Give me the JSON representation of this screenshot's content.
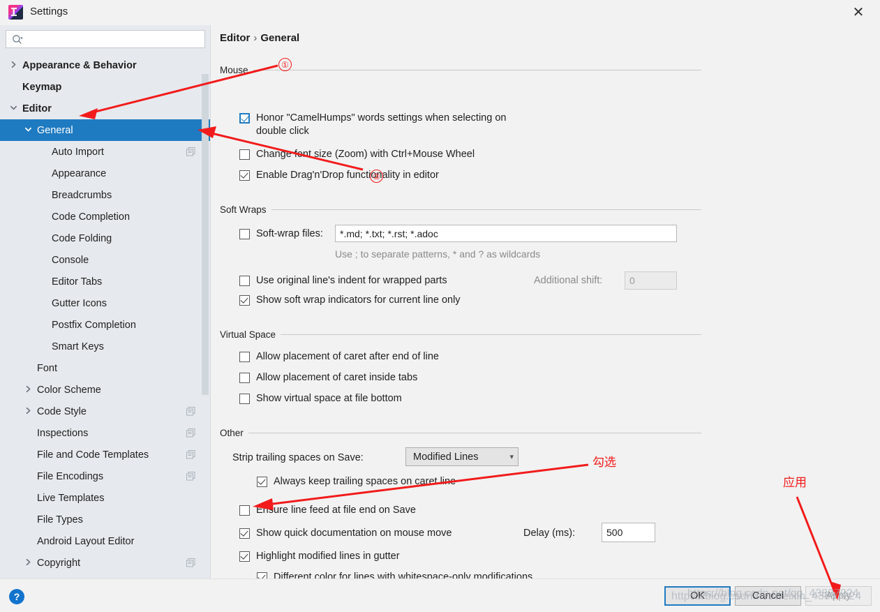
{
  "window": {
    "title": "Settings",
    "logo_icon": "intellij-idea-icon",
    "close_icon": "close-icon"
  },
  "sidebar": {
    "search": {
      "placeholder": "",
      "value": "",
      "icon": "search-icon"
    },
    "items": [
      {
        "label": "Appearance & Behavior",
        "indent": 0,
        "chevron": "right",
        "bold": true,
        "selected": false,
        "badge": false
      },
      {
        "label": "Keymap",
        "indent": 0,
        "chevron": "none",
        "bold": true,
        "selected": false,
        "badge": false
      },
      {
        "label": "Editor",
        "indent": 0,
        "chevron": "down",
        "bold": true,
        "selected": false,
        "badge": false
      },
      {
        "label": "General",
        "indent": 1,
        "chevron": "down",
        "bold": false,
        "selected": true,
        "badge": false
      },
      {
        "label": "Auto Import",
        "indent": 2,
        "chevron": "none",
        "bold": false,
        "selected": false,
        "badge": true
      },
      {
        "label": "Appearance",
        "indent": 2,
        "chevron": "none",
        "bold": false,
        "selected": false,
        "badge": false
      },
      {
        "label": "Breadcrumbs",
        "indent": 2,
        "chevron": "none",
        "bold": false,
        "selected": false,
        "badge": false
      },
      {
        "label": "Code Completion",
        "indent": 2,
        "chevron": "none",
        "bold": false,
        "selected": false,
        "badge": false
      },
      {
        "label": "Code Folding",
        "indent": 2,
        "chevron": "none",
        "bold": false,
        "selected": false,
        "badge": false
      },
      {
        "label": "Console",
        "indent": 2,
        "chevron": "none",
        "bold": false,
        "selected": false,
        "badge": false
      },
      {
        "label": "Editor Tabs",
        "indent": 2,
        "chevron": "none",
        "bold": false,
        "selected": false,
        "badge": false
      },
      {
        "label": "Gutter Icons",
        "indent": 2,
        "chevron": "none",
        "bold": false,
        "selected": false,
        "badge": false
      },
      {
        "label": "Postfix Completion",
        "indent": 2,
        "chevron": "none",
        "bold": false,
        "selected": false,
        "badge": false
      },
      {
        "label": "Smart Keys",
        "indent": 2,
        "chevron": "none",
        "bold": false,
        "selected": false,
        "badge": false
      },
      {
        "label": "Font",
        "indent": 1,
        "chevron": "none",
        "bold": false,
        "selected": false,
        "badge": false
      },
      {
        "label": "Color Scheme",
        "indent": 1,
        "chevron": "right",
        "bold": false,
        "selected": false,
        "badge": false
      },
      {
        "label": "Code Style",
        "indent": 1,
        "chevron": "right",
        "bold": false,
        "selected": false,
        "badge": true
      },
      {
        "label": "Inspections",
        "indent": 1,
        "chevron": "none",
        "bold": false,
        "selected": false,
        "badge": true
      },
      {
        "label": "File and Code Templates",
        "indent": 1,
        "chevron": "none",
        "bold": false,
        "selected": false,
        "badge": true
      },
      {
        "label": "File Encodings",
        "indent": 1,
        "chevron": "none",
        "bold": false,
        "selected": false,
        "badge": true
      },
      {
        "label": "Live Templates",
        "indent": 1,
        "chevron": "none",
        "bold": false,
        "selected": false,
        "badge": false
      },
      {
        "label": "File Types",
        "indent": 1,
        "chevron": "none",
        "bold": false,
        "selected": false,
        "badge": false
      },
      {
        "label": "Android Layout Editor",
        "indent": 1,
        "chevron": "none",
        "bold": false,
        "selected": false,
        "badge": false
      },
      {
        "label": "Copyright",
        "indent": 1,
        "chevron": "right",
        "bold": false,
        "selected": false,
        "badge": true
      }
    ]
  },
  "main": {
    "breadcrumb": {
      "root": "Editor",
      "separator": "›",
      "leaf": "General"
    },
    "sections": {
      "mouse": {
        "title": "Mouse",
        "options": [
          {
            "label": "Honor \"CamelHumps\" words settings when selecting on double click",
            "checked": true,
            "focused": true
          },
          {
            "label": "Change font size (Zoom) with Ctrl+Mouse Wheel",
            "checked": false,
            "focused": false
          },
          {
            "label": "Enable Drag'n'Drop functionality in editor",
            "checked": true,
            "focused": false
          }
        ]
      },
      "soft_wraps": {
        "title": "Soft Wraps",
        "softwrap_files_label": "Soft-wrap files:",
        "softwrap_files_checked": false,
        "softwrap_files_value": "*.md; *.txt; *.rst; *.adoc",
        "hint": "Use ; to separate patterns, * and ? as wildcards",
        "use_original_indent_label": "Use original line's indent for wrapped parts",
        "use_original_indent_checked": false,
        "additional_shift_label": "Additional shift:",
        "additional_shift_value": "0",
        "additional_shift_disabled": true,
        "show_indicators_label": "Show soft wrap indicators for current line only",
        "show_indicators_checked": true
      },
      "virtual_space": {
        "title": "Virtual Space",
        "options": [
          {
            "label": "Allow placement of caret after end of line",
            "checked": false
          },
          {
            "label": "Allow placement of caret inside tabs",
            "checked": false
          },
          {
            "label": "Show virtual space at file bottom",
            "checked": false
          }
        ]
      },
      "other": {
        "title": "Other",
        "strip_label": "Strip trailing spaces on Save:",
        "strip_value": "Modified Lines",
        "strip_caret_icon": "chevron-down-icon",
        "always_keep_label": "Always keep trailing spaces on caret line",
        "always_keep_checked": true,
        "ensure_lf_label": "Ensure line feed at file end on Save",
        "ensure_lf_checked": false,
        "quick_doc_label": "Show quick documentation on mouse move",
        "quick_doc_checked": true,
        "delay_label": "Delay (ms):",
        "delay_value": "500",
        "highlight_label": "Highlight modified lines in gutter",
        "highlight_checked": true,
        "different_color_label": "Different color for lines with whitespace-only modifications",
        "different_color_checked": true
      }
    }
  },
  "footer": {
    "help_label": "?",
    "ok_label": "OK",
    "cancel_label": "Cancel",
    "apply_label": "Apply",
    "apply_disabled": true
  },
  "annotations": {
    "marker_one": "①",
    "marker_two": "②",
    "note_check": "勾选",
    "note_apply": "应用",
    "accent_color": "#f21b1b"
  },
  "watermark": {
    "line1": "https://blog.csdn.net/qq_43887224",
    "line2": "https://blog.csdn.net/weixin_43887224"
  }
}
